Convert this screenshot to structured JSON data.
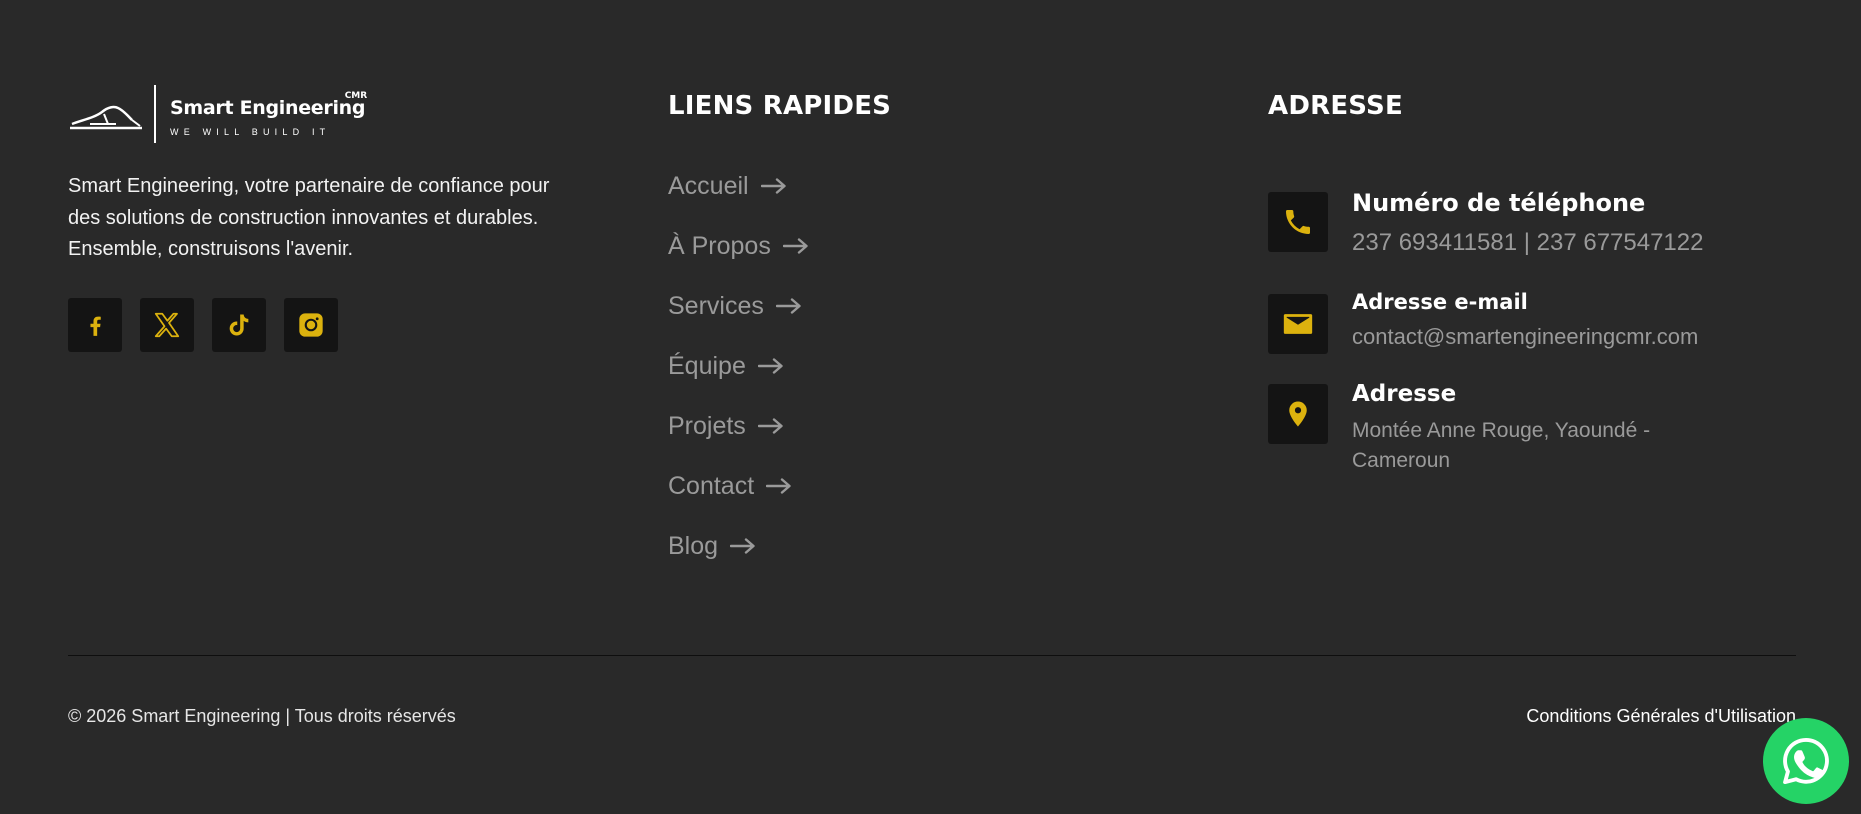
{
  "brand": {
    "logo_name": "Smart Engineering",
    "logo_badge": "CMR",
    "logo_tagline": "WE WILL BUILD IT",
    "description": "Smart Engineering, votre partenaire de confiance pour des solutions de construction innovantes et durables. Ensemble, construisons l'avenir.",
    "socials": [
      {
        "name": "facebook",
        "icon": "facebook-icon"
      },
      {
        "name": "x",
        "icon": "x-icon"
      },
      {
        "name": "tiktok",
        "icon": "tiktok-icon"
      },
      {
        "name": "instagram",
        "icon": "instagram-icon"
      }
    ]
  },
  "links": {
    "title": "LIENS RAPIDES",
    "items": [
      {
        "label": "Accueil"
      },
      {
        "label": "À Propos"
      },
      {
        "label": "Services"
      },
      {
        "label": "Équipe"
      },
      {
        "label": "Projets"
      },
      {
        "label": "Contact"
      },
      {
        "label": "Blog"
      }
    ]
  },
  "address": {
    "title": "ADRESSE",
    "phone": {
      "label": "Numéro de téléphone",
      "value": "237 693411581 | 237 677547122",
      "icon": "phone-icon"
    },
    "email": {
      "label": "Adresse e-mail",
      "value": "contact@smartengineeringcmr.com",
      "icon": "mail-icon"
    },
    "location": {
      "label": "Adresse",
      "value": "Montée Anne Rouge, Yaoundé - Cameroun",
      "icon": "location-pin-icon"
    }
  },
  "bottom": {
    "copyright": "© 2026 Smart Engineering | Tous droits réservés",
    "terms": "Conditions Générales d'Utilisation"
  },
  "colors": {
    "background": "#292929",
    "icon_box": "#141414",
    "accent": "#dcb20e",
    "muted_text": "#9a9a9a",
    "whatsapp": "#25d366"
  }
}
